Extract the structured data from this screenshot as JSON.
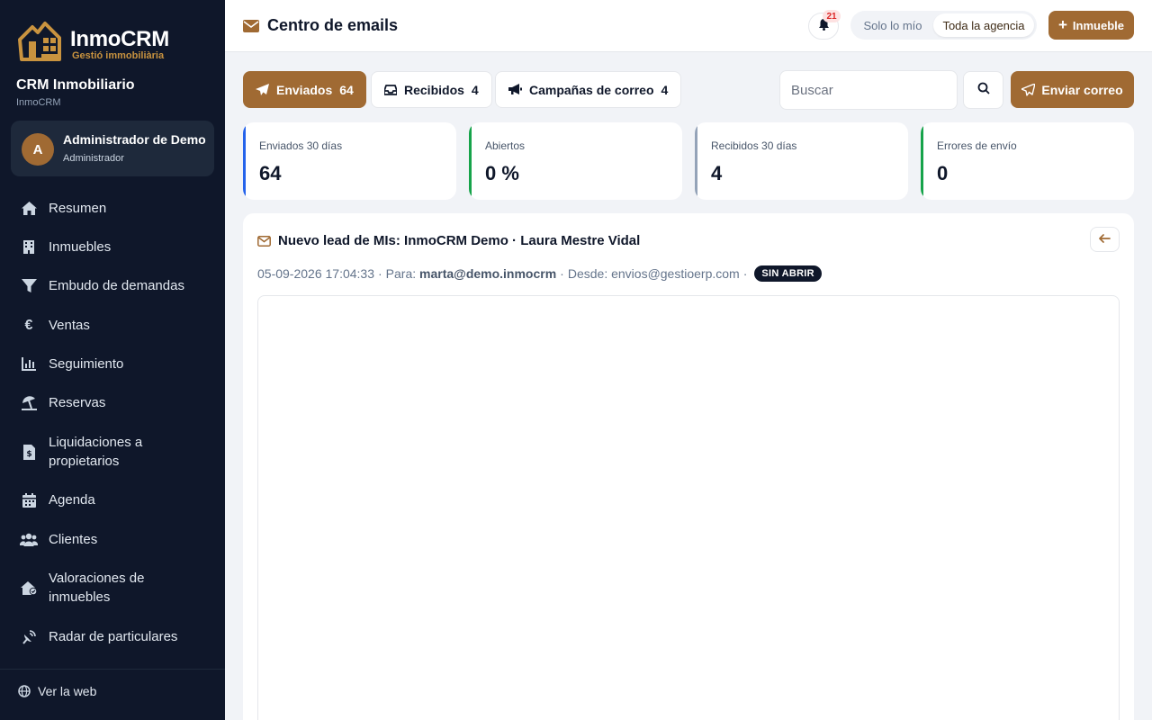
{
  "brand": {
    "name": "InmoCRM",
    "tagline": "Gestió immobiliària",
    "crm_title": "CRM Inmobiliario",
    "crm_sub": "InmoCRM",
    "accent_color": "#a06a33"
  },
  "user": {
    "initial": "A",
    "name": "Administrador de Demo",
    "role": "Administrador"
  },
  "sidebar": {
    "items": [
      {
        "label": "Resumen",
        "icon": "home-icon"
      },
      {
        "label": "Inmuebles",
        "icon": "building-icon"
      },
      {
        "label": "Embudo de demandas",
        "icon": "funnel-icon"
      },
      {
        "label": "Ventas",
        "icon": "euro-icon"
      },
      {
        "label": "Seguimiento",
        "icon": "chart-icon"
      },
      {
        "label": "Reservas",
        "icon": "umbrella-beach-icon"
      },
      {
        "label": "Liquidaciones a propietarios",
        "icon": "invoice-icon"
      },
      {
        "label": "Agenda",
        "icon": "calendar-icon"
      },
      {
        "label": "Clientes",
        "icon": "users-icon"
      },
      {
        "label": "Valoraciones de inmuebles",
        "icon": "house-check-icon"
      },
      {
        "label": "Radar de particulares",
        "icon": "satellite-dish-icon"
      }
    ],
    "footer_link": "Ver la web"
  },
  "header": {
    "title": "Centro de emails",
    "notifications_count": "21",
    "scope_options": [
      "Solo lo mío",
      "Toda la agencia"
    ],
    "scope_selected": "Toda la agencia",
    "add_label": "Inmueble"
  },
  "tabs": [
    {
      "label": "Enviados",
      "count": "64",
      "active": true
    },
    {
      "label": "Recibidos",
      "count": "4",
      "active": false
    },
    {
      "label": "Campañas de correo",
      "count": "4",
      "active": false
    }
  ],
  "search": {
    "placeholder": "Buscar"
  },
  "send_label": "Enviar correo",
  "stats": [
    {
      "label": "Enviados 30 días",
      "value": "64",
      "color": "#2563eb"
    },
    {
      "label": "Abiertos",
      "value": "0 %",
      "color": "#16a34a"
    },
    {
      "label": "Recibidos 30 días",
      "value": "4",
      "color": "#94a3b8"
    },
    {
      "label": "Errores de envío",
      "value": "0",
      "color": "#16a34a"
    }
  ],
  "email": {
    "subject": "Nuevo lead de MIs: InmoCRM Demo · Laura Mestre Vidal",
    "datetime": "05-09-2026 17:04:33",
    "to_label": "Para:",
    "to": "marta@demo.inmocrm",
    "from_label": "Desde:",
    "from": "envios@gestioerp.com",
    "status": "SIN ABRIR"
  }
}
